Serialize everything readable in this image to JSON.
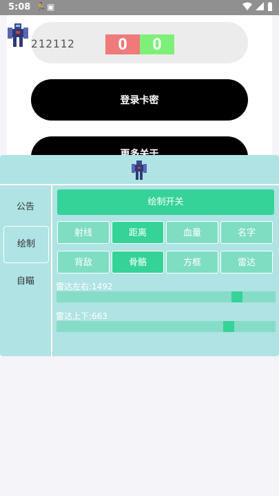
{
  "status_bar": {
    "time": "5:08"
  },
  "login": {
    "card_input_value": "212112",
    "score_red": "0",
    "score_green": "0",
    "login_button_label": "登录卡密",
    "second_button_label": "更多关于"
  },
  "panel": {
    "sidebar": [
      {
        "label": "公告",
        "active": false
      },
      {
        "label": "绘制",
        "active": true
      },
      {
        "label": "自瞄",
        "active": false
      }
    ],
    "draw_switch_label": "绘制开关",
    "options_row1": [
      {
        "label": "射线",
        "on": false
      },
      {
        "label": "距离",
        "on": true
      },
      {
        "label": "血量",
        "on": false
      },
      {
        "label": "名字",
        "on": false
      }
    ],
    "options_row2": [
      {
        "label": "背敌",
        "on": false
      },
      {
        "label": "骨骼",
        "on": true
      },
      {
        "label": "方框",
        "on": false
      },
      {
        "label": "雷达",
        "on": false
      }
    ],
    "slider_lr_label": "雷达左右:1492",
    "slider_lr_value": 0.84,
    "slider_ud_label": "雷达上下:663",
    "slider_ud_value": 0.8
  },
  "colors": {
    "accent": "#35d397",
    "panel_bg": "#b0e3e3",
    "score_red": "#f07a7a",
    "score_green": "#7ef07a"
  }
}
